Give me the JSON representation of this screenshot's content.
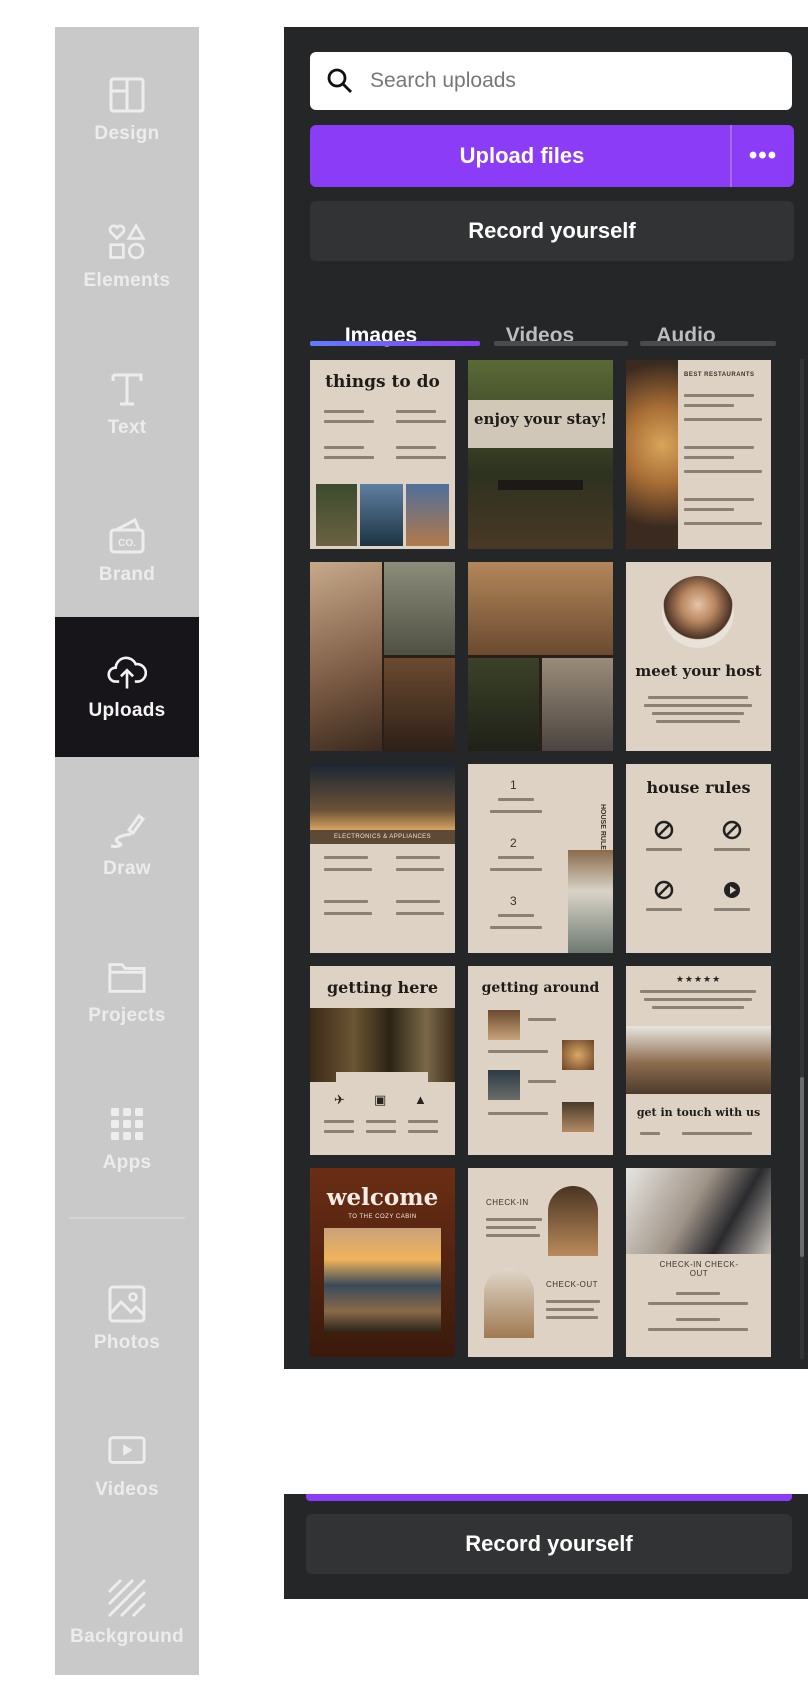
{
  "sidebar": {
    "items": [
      {
        "label": "Design",
        "icon": "layout-icon"
      },
      {
        "label": "Elements",
        "icon": "shapes-icon"
      },
      {
        "label": "Text",
        "icon": "text-icon"
      },
      {
        "label": "Brand",
        "icon": "brand-icon"
      },
      {
        "label": "Uploads",
        "icon": "cloud-upload-icon",
        "active": true
      },
      {
        "label": "Draw",
        "icon": "pen-icon"
      },
      {
        "label": "Projects",
        "icon": "folder-icon"
      },
      {
        "label": "Apps",
        "icon": "apps-grid-icon"
      },
      {
        "label": "Photos",
        "icon": "photo-icon"
      },
      {
        "label": "Videos",
        "icon": "video-icon"
      },
      {
        "label": "Background",
        "icon": "background-icon"
      }
    ]
  },
  "panel": {
    "search_placeholder": "Search uploads",
    "upload_label": "Upload files",
    "more_label": "•••",
    "record_label": "Record yourself",
    "tabs": [
      {
        "label": "Images",
        "active": true
      },
      {
        "label": "Videos"
      },
      {
        "label": "Audio"
      }
    ],
    "thumbnails": [
      {
        "title": "things to do"
      },
      {
        "title": "enjoy your stay!"
      },
      {
        "title": "BEST RESTAURANTS"
      },
      {
        "title": ""
      },
      {
        "title": ""
      },
      {
        "title": "meet your host"
      },
      {
        "title": "ELECTRONICS & APPLIANCES"
      },
      {
        "title": "HOUSE RULES",
        "numbers": [
          "1",
          "2",
          "3"
        ]
      },
      {
        "title": "house rules"
      },
      {
        "title": "getting here"
      },
      {
        "title": "getting around"
      },
      {
        "title": "get in touch with us",
        "stars": "★★★★★"
      },
      {
        "title": "welcome",
        "subtitle": "TO THE COZY CABIN"
      },
      {
        "title": "CHECK-IN",
        "title2": "CHECK-OUT"
      },
      {
        "title": "CHECK-IN CHECK-OUT"
      }
    ]
  },
  "ghost_panel": {
    "record_label": "Record yourself"
  },
  "colors": {
    "accent": "#8b3cf7",
    "panel_bg": "#252627",
    "rail_bg": "#c9c9c9",
    "rail_active": "#17151a"
  }
}
